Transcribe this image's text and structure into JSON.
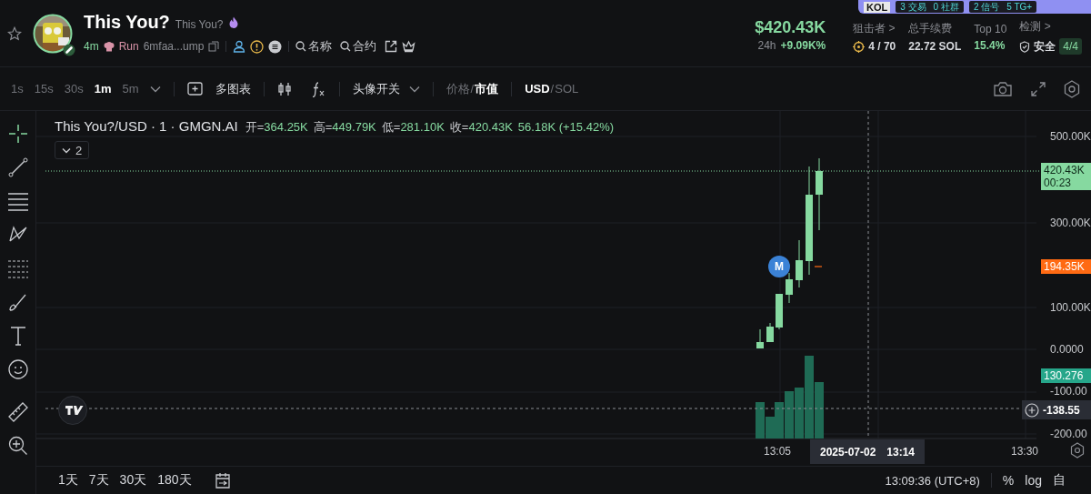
{
  "top_banner": {
    "badge": "KOL",
    "groups": [
      [
        "3 交易",
        "0 社群"
      ],
      [
        "2 信号",
        "5 TG+"
      ]
    ]
  },
  "token": {
    "name": "This You?",
    "subtitle": "This You?",
    "age": "4m",
    "platform": "Run",
    "address": "6mfaa...ump",
    "links": [
      "名称",
      "合约"
    ]
  },
  "stats": {
    "market_cap": "$420.43K",
    "change_label": "24h",
    "change": "+9.09K%",
    "metrics": [
      {
        "label": "狙击者 >",
        "value": "4 / 70",
        "kind": "sniper"
      },
      {
        "label": "总手续费",
        "value": "22.72 SOL",
        "kind": "plain"
      },
      {
        "label": "Top 10",
        "value": "15.4%",
        "kind": "good"
      },
      {
        "label": "检测 >",
        "value": "安全",
        "badge": "4/4",
        "kind": "safety"
      }
    ]
  },
  "toolbar": {
    "intervals": [
      {
        "label": "1s",
        "selected": false
      },
      {
        "label": "15s",
        "selected": false
      },
      {
        "label": "30s",
        "selected": false
      },
      {
        "label": "1m",
        "selected": true
      },
      {
        "label": "5m",
        "selected": false
      }
    ],
    "multi_chart": "多图表",
    "avatar_toggle": "头像开关",
    "value_modes": [
      {
        "label": "价格",
        "selected": false
      },
      {
        "label": "市值",
        "selected": true
      }
    ],
    "currencies": [
      {
        "label": "USD",
        "selected": true
      },
      {
        "label": "SOL",
        "selected": false
      }
    ],
    "separator": "/"
  },
  "legend": {
    "symbol": "This You?/USD · 1 · GMGN.AI",
    "ohlc": [
      {
        "label": "开=",
        "value": "364.25K"
      },
      {
        "label": "高=",
        "value": "449.79K"
      },
      {
        "label": "低=",
        "value": "281.10K"
      },
      {
        "label": "收=",
        "value": "420.43K"
      }
    ],
    "change": "56.18K (+15.42%)",
    "indicator_count": "2"
  },
  "price_axis": [
    "500.00K",
    "300.00K",
    "100.00K",
    "0.0000",
    "-100.00",
    "-200.00"
  ],
  "price_tags": [
    {
      "text": "420.43K",
      "sub": "00:23",
      "kind": "last"
    },
    {
      "text": "194.35K",
      "kind": "average"
    },
    {
      "text": "130.276",
      "kind": "volume"
    }
  ],
  "crosshair_price": "-138.55",
  "marker": "M",
  "time_axis": [
    "13:05",
    "13:30"
  ],
  "crosshair_time": {
    "date": "2025-07-02",
    "time": "13:14"
  },
  "ranges": [
    "1天",
    "7天",
    "30天",
    "180天"
  ],
  "clock": "13:09:36 (UTC+8)",
  "scale_options": [
    "%",
    "log",
    "自"
  ]
}
